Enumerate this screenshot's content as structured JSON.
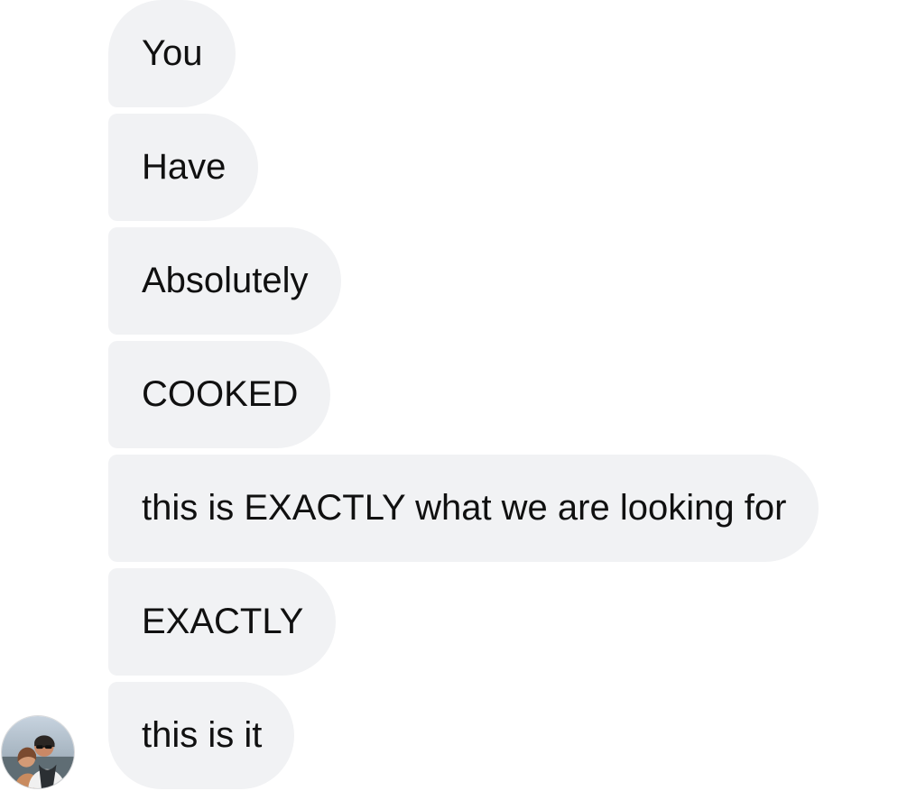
{
  "thread": {
    "messages": [
      {
        "text": "You"
      },
      {
        "text": "Have"
      },
      {
        "text": "Absolutely"
      },
      {
        "text": "COOKED"
      },
      {
        "text": "this is EXACTLY what we are looking for"
      },
      {
        "text": "EXACTLY"
      },
      {
        "text": "this is it"
      }
    ],
    "avatar": {
      "icon": "user-photo-avatar"
    },
    "colors": {
      "bubble_background": "#f1f2f4",
      "text": "#101010",
      "page_background": "#ffffff"
    }
  }
}
